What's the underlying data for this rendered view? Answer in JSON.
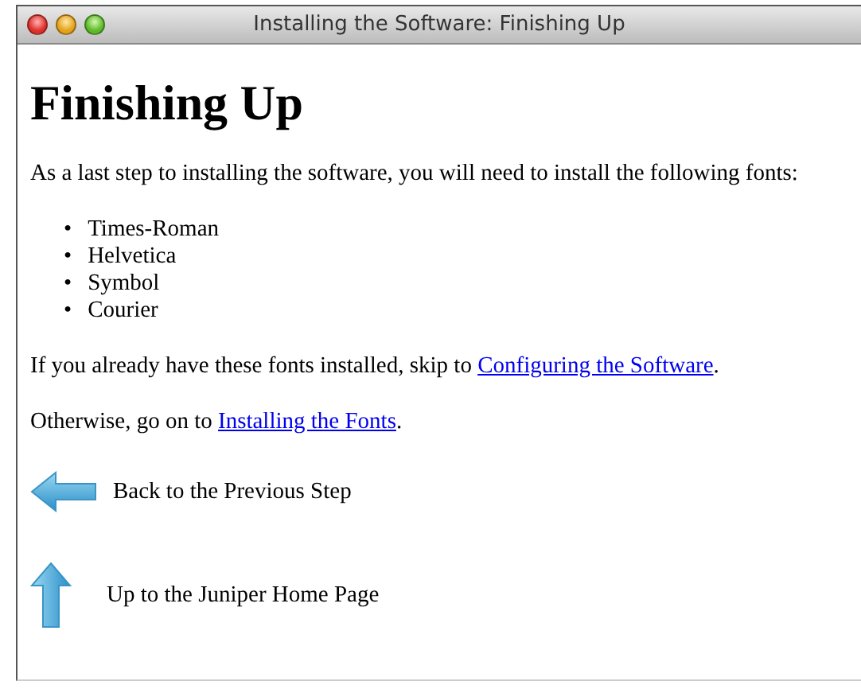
{
  "window": {
    "title": "Installing the Software: Finishing Up"
  },
  "heading": "Finishing Up",
  "intro": "As a last step to installing the software, you will need to install the following fonts:",
  "fonts": [
    {
      "marker": "•",
      "name": "Times-Roman"
    },
    {
      "marker": "•",
      "name": "Helvetica"
    },
    {
      "marker": "•",
      "name": "Symbol"
    },
    {
      "marker": "•",
      "name": "Courier"
    }
  ],
  "paragraphs": [
    {
      "text_before": "If you already have these fonts installed, skip to ",
      "link": "Configuring the Software",
      "text_after": "."
    },
    {
      "text_before": "Otherwise, go on to ",
      "link": "Installing the Fonts",
      "text_after": "."
    }
  ],
  "navigation": [
    {
      "kind": "back",
      "label": "Back to the Previous Step"
    },
    {
      "kind": "up",
      "label": "Up to the Juniper Home Page"
    }
  ]
}
